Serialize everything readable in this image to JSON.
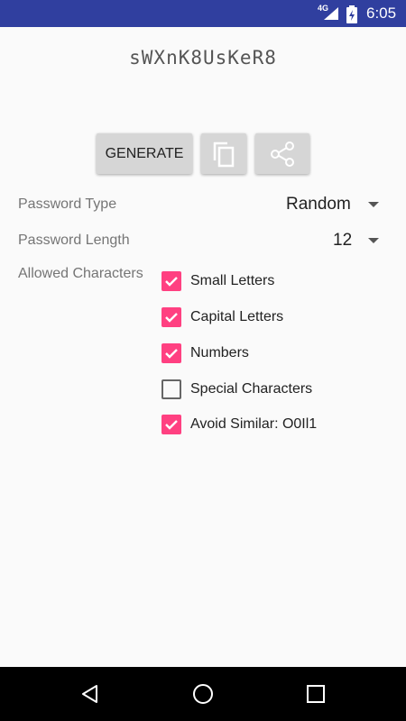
{
  "status_bar": {
    "network": "4G",
    "time": "6:05",
    "background": "#303f9f"
  },
  "password": "sWXnK8UsKeR8",
  "buttons": {
    "generate_label": "GENERATE",
    "copy_icon": "copy-icon",
    "share_icon": "share-icon"
  },
  "settings": {
    "password_type_label": "Password Type",
    "password_type_value": "Random",
    "password_length_label": "Password Length",
    "password_length_value": "12",
    "allowed_characters_label": "Allowed Characters"
  },
  "checkboxes": [
    {
      "label": "Small Letters",
      "checked": true
    },
    {
      "label": "Capital Letters",
      "checked": true
    },
    {
      "label": "Numbers",
      "checked": true
    },
    {
      "label": "Special Characters",
      "checked": false
    },
    {
      "label": "Avoid Similar: O0Il1",
      "checked": true
    }
  ],
  "colors": {
    "accent": "#ff4081",
    "button_bg": "#d6d6d6"
  }
}
